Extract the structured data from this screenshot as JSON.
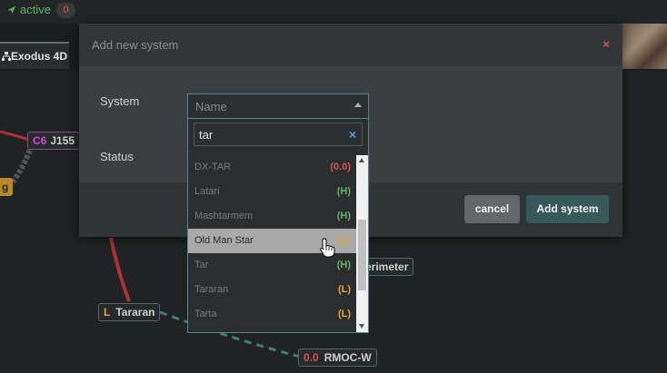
{
  "topbar": {
    "active_label": "active",
    "active_count": "0"
  },
  "map": {
    "tab_label": "Exodus 4D",
    "nodes": {
      "c6_prefix": "C6",
      "c6_name": "J155",
      "g_prefix": "g",
      "perimeter_name": "erimeter",
      "tararan_prefix": "L",
      "tararan_name": "Tararan",
      "rmoc_prefix": "0.0",
      "rmoc_name": "RMOC-W"
    }
  },
  "modal": {
    "title": "Add new system",
    "close": "×",
    "system_label": "System",
    "status_label": "Status",
    "select_placeholder": "Name",
    "search_value": "tar",
    "search_clear": "×",
    "cancel_label": "cancel",
    "add_label": "Add system"
  },
  "results": [
    {
      "name": "DX-TAR",
      "security": "(0.0)"
    },
    {
      "name": "Latari",
      "security": "(H)"
    },
    {
      "name": "Mashtarmem",
      "security": "(H)"
    },
    {
      "name": "Old Man Star",
      "security": "(L)"
    },
    {
      "name": "Tar",
      "security": "(H)"
    },
    {
      "name": "Tararan",
      "security": "(L)"
    },
    {
      "name": "Tarta",
      "security": "(L)"
    }
  ],
  "colors": {
    "accent": "#4f8a8b",
    "high_sec": "#5cb85c",
    "low_sec": "#e3a532",
    "null_sec": "#d9534f",
    "close": "#d9534f"
  },
  "icons": {
    "active": "plane-icon",
    "tab": "sitemap-icon",
    "close": "close-icon",
    "clear": "clear-icon",
    "cursor": "hand-pointer-icon"
  }
}
